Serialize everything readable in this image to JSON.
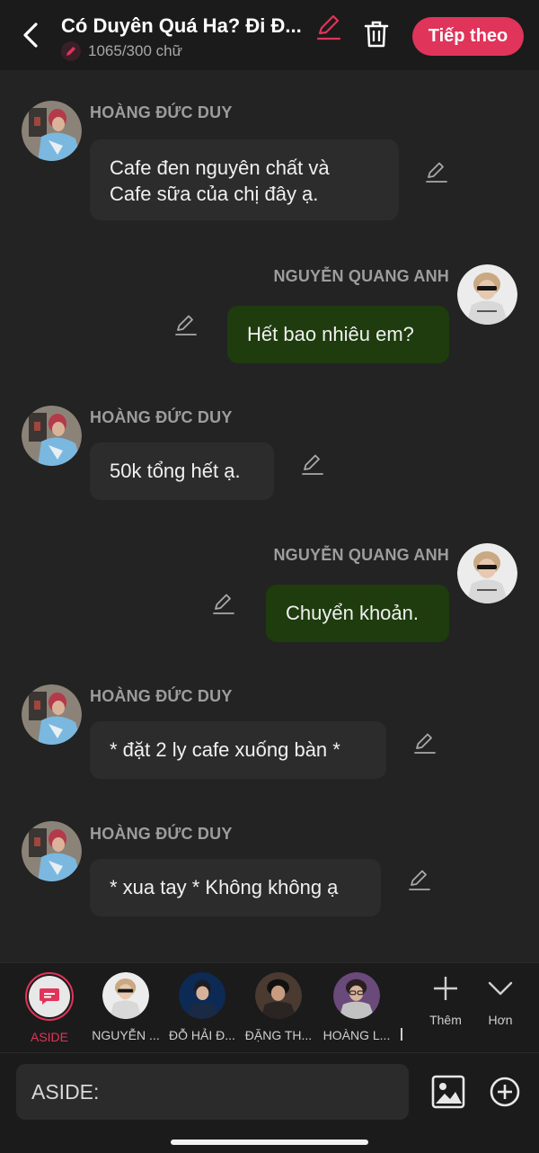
{
  "header": {
    "title": "Có Duyên Quá Ha? Đi Đ...",
    "char_count": "1065/300 chữ",
    "next_label": "Tiếp theo"
  },
  "messages": [
    {
      "speaker": "HOÀNG ĐỨC DUY",
      "line1": "Cafe đen nguyên chất và",
      "line2": "Cafe sữa của chị đây ạ."
    },
    {
      "speaker": "NGUYỄN QUANG ANH",
      "line1": "Hết bao nhiêu em?"
    },
    {
      "speaker": "HOÀNG ĐỨC DUY",
      "line1": "50k tổng hết ạ."
    },
    {
      "speaker": "NGUYỄN QUANG ANH",
      "line1": "Chuyển khoản."
    },
    {
      "speaker": "HOÀNG ĐỨC DUY",
      "line1": "* đặt 2 ly cafe xuống bàn *"
    },
    {
      "speaker": "HOÀNG ĐỨC DUY",
      "line1": "* xua tay * Không không ạ"
    }
  ],
  "characters": [
    {
      "label": "ASIDE"
    },
    {
      "label": "NGUYỄN ..."
    },
    {
      "label": "ĐỖ HẢI Đ..."
    },
    {
      "label": "ĐẶNG TH..."
    },
    {
      "label": "HOÀNG L..."
    }
  ],
  "tools": {
    "more_label": "Thêm",
    "collapse_label": "Hơn"
  },
  "input": {
    "placeholder": "ASIDE:"
  },
  "colors": {
    "accent": "#e0345a",
    "right_bubble": "#1e3c0d",
    "left_bubble": "#2c2c2c",
    "background": "#232323"
  },
  "icons": [
    "back-icon",
    "pencil-icon",
    "trash-icon",
    "edit-icon",
    "image-icon",
    "plus-icon",
    "chevron-down-icon",
    "aside-icon"
  ]
}
